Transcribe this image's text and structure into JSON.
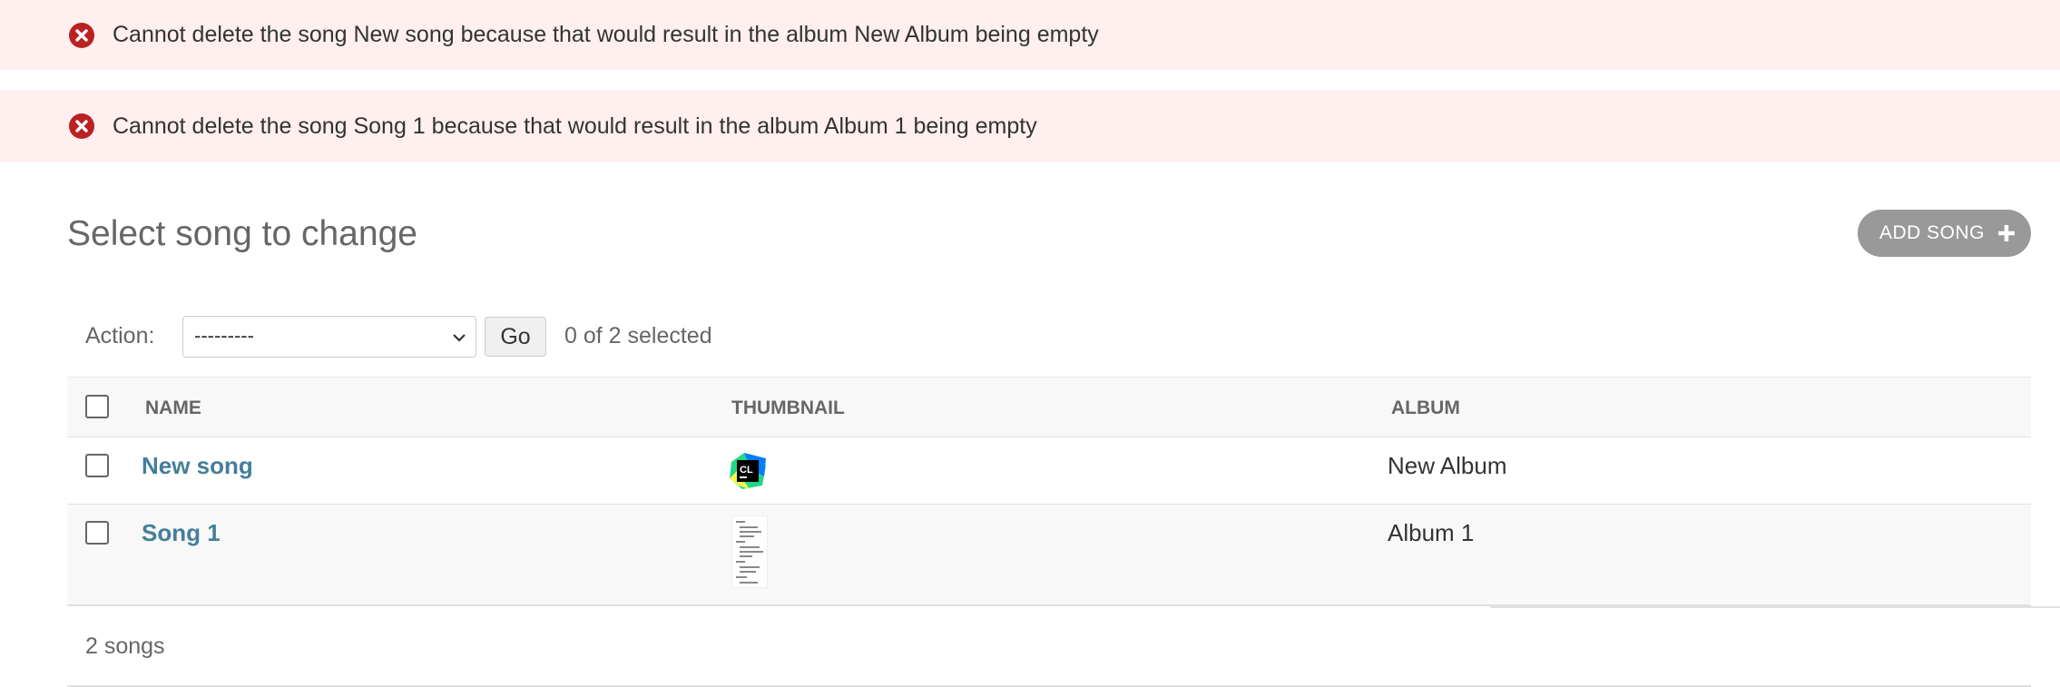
{
  "messages": [
    {
      "text": "Cannot delete the song New song because that would result in the album New Album being empty"
    },
    {
      "text": "Cannot delete the song Song 1 because that would result in the album Album 1 being empty"
    }
  ],
  "page_title": "Select song to change",
  "add_button": {
    "label": "ADD SONG"
  },
  "actions": {
    "label": "Action:",
    "selected": "---------",
    "go_label": "Go",
    "counter": "0 of 2 selected"
  },
  "table": {
    "columns": [
      "NAME",
      "THUMBNAIL",
      "ALBUM"
    ],
    "rows": [
      {
        "name": "New song",
        "album": "New Album",
        "thumbnail": "CL"
      },
      {
        "name": "Song 1",
        "album": "Album 1",
        "thumbnail": "document-preview"
      }
    ]
  },
  "footer": {
    "count": "2 songs"
  },
  "colors": {
    "error_bg": "#ffefef",
    "error_icon": "#ba2121",
    "link": "#447e9b",
    "button_bg": "#999999"
  }
}
